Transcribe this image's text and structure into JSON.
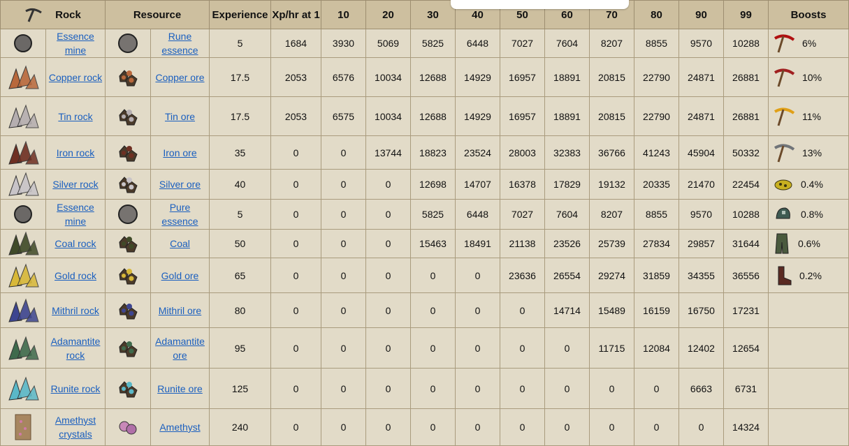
{
  "headers": {
    "rock": "Rock",
    "resource": "Resource",
    "experience": "Experience",
    "xphr": "Xp/hr at 1",
    "levels": [
      "10",
      "20",
      "30",
      "40",
      "50",
      "60",
      "70",
      "80",
      "90",
      "99"
    ],
    "boosts": "Boosts"
  },
  "rows": [
    {
      "rock": "Essence mine",
      "rock_icon": "essence-mine-icon",
      "resource": "Rune essence",
      "resource_icon": "rune-essence-icon",
      "xp": "5",
      "xphr": "1684",
      "lv": [
        "3930",
        "5069",
        "5825",
        "6448",
        "7027",
        "7604",
        "8207",
        "8855",
        "9570",
        "10288"
      ],
      "boost_icon": "dragon-pickaxe-icon",
      "boost": "6%"
    },
    {
      "rock": "Copper rock",
      "rock_icon": "copper-rock-icon",
      "resource": "Copper ore",
      "resource_icon": "copper-ore-icon",
      "xp": "17.5",
      "xphr": "2053",
      "lv": [
        "6576",
        "10034",
        "12688",
        "14929",
        "16957",
        "18891",
        "20815",
        "22790",
        "24871",
        "26881"
      ],
      "boost_icon": "infernal-pickaxe-icon",
      "boost": "10%"
    },
    {
      "rock": "Tin rock",
      "rock_icon": "tin-rock-icon",
      "resource": "Tin ore",
      "resource_icon": "tin-ore-icon",
      "xp": "17.5",
      "xphr": "2053",
      "lv": [
        "6575",
        "10034",
        "12688",
        "14929",
        "16957",
        "18891",
        "20815",
        "22790",
        "24871",
        "26881"
      ],
      "boost_icon": "gold-pickaxe-icon",
      "boost": "11%"
    },
    {
      "rock": "Iron rock",
      "rock_icon": "iron-rock-icon",
      "resource": "Iron ore",
      "resource_icon": "iron-ore-icon",
      "xp": "35",
      "xphr": "0",
      "lv": [
        "0",
        "13744",
        "18823",
        "23524",
        "28003",
        "32383",
        "36766",
        "41243",
        "45904",
        "50332"
      ],
      "boost_icon": "steel-pickaxe-icon",
      "boost": "13%"
    },
    {
      "rock": "Silver rock",
      "rock_icon": "silver-rock-icon",
      "resource": "Silver ore",
      "resource_icon": "silver-ore-icon",
      "xp": "40",
      "xphr": "0",
      "lv": [
        "0",
        "0",
        "12698",
        "14707",
        "16378",
        "17829",
        "19132",
        "20335",
        "21470",
        "22454"
      ],
      "boost_icon": "golden-nugget-icon",
      "boost": "0.4%"
    },
    {
      "rock": "Essence mine",
      "rock_icon": "essence-mine-icon",
      "resource": "Pure essence",
      "resource_icon": "pure-essence-icon",
      "xp": "5",
      "xphr": "0",
      "lv": [
        "0",
        "0",
        "5825",
        "6448",
        "7027",
        "7604",
        "8207",
        "8855",
        "9570",
        "10288"
      ],
      "boost_icon": "prospector-helmet-icon",
      "boost": "0.8%"
    },
    {
      "rock": "Coal rock",
      "rock_icon": "coal-rock-icon",
      "resource": "Coal",
      "resource_icon": "coal-icon",
      "xp": "50",
      "xphr": "0",
      "lv": [
        "0",
        "0",
        "15463",
        "18491",
        "21138",
        "23526",
        "25739",
        "27834",
        "29857",
        "31644"
      ],
      "boost_icon": "prospector-legs-icon",
      "boost": "0.6%"
    },
    {
      "rock": "Gold rock",
      "rock_icon": "gold-rock-icon",
      "resource": "Gold ore",
      "resource_icon": "gold-ore-icon",
      "xp": "65",
      "xphr": "0",
      "lv": [
        "0",
        "0",
        "0",
        "0",
        "23636",
        "26554",
        "29274",
        "31859",
        "34355",
        "36556"
      ],
      "boost_icon": "prospector-boots-icon",
      "boost": "0.2%"
    },
    {
      "rock": "Mithril rock",
      "rock_icon": "mithril-rock-icon",
      "resource": "Mithril ore",
      "resource_icon": "mithril-ore-icon",
      "xp": "80",
      "xphr": "0",
      "lv": [
        "0",
        "0",
        "0",
        "0",
        "0",
        "14714",
        "15489",
        "16159",
        "16750",
        "17231"
      ],
      "boost_icon": "",
      "boost": ""
    },
    {
      "rock": "Adamantite rock",
      "rock_icon": "adamantite-rock-icon",
      "resource": "Adamantite ore",
      "resource_icon": "adamantite-ore-icon",
      "xp": "95",
      "xphr": "0",
      "lv": [
        "0",
        "0",
        "0",
        "0",
        "0",
        "0",
        "11715",
        "12084",
        "12402",
        "12654"
      ],
      "boost_icon": "",
      "boost": ""
    },
    {
      "rock": "Runite rock",
      "rock_icon": "runite-rock-icon",
      "resource": "Runite ore",
      "resource_icon": "runite-ore-icon",
      "xp": "125",
      "xphr": "0",
      "lv": [
        "0",
        "0",
        "0",
        "0",
        "0",
        "0",
        "0",
        "0",
        "6663",
        "6731"
      ],
      "boost_icon": "",
      "boost": ""
    },
    {
      "rock": "Amethyst crystals",
      "rock_icon": "amethyst-crystals-icon",
      "resource": "Amethyst",
      "resource_icon": "amethyst-icon",
      "xp": "240",
      "xphr": "0",
      "lv": [
        "0",
        "0",
        "0",
        "0",
        "0",
        "0",
        "0",
        "0",
        "0",
        "14324"
      ],
      "boost_icon": "",
      "boost": ""
    }
  ],
  "colors": {
    "essence": "#6b6866",
    "copper": "#b8683c",
    "tin": "#b5aeb0",
    "iron": "#6e2f22",
    "silver": "#c8c4c8",
    "coal": "#3f4a28",
    "gold": "#d8b838",
    "mithril": "#3d4590",
    "adamantite": "#3e6a4c",
    "runite": "#5ab8c8",
    "amethyst": "#b07a90"
  }
}
